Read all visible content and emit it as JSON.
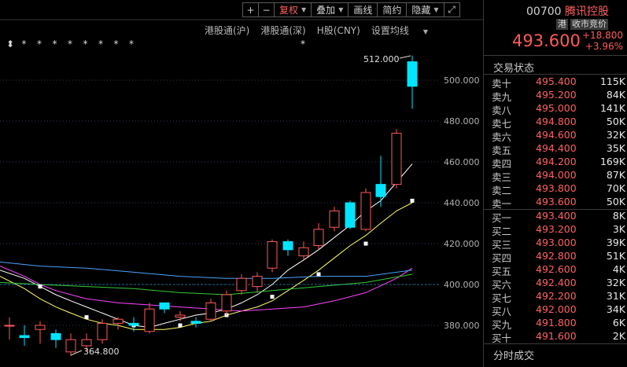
{
  "toolbar": {
    "plus": "+",
    "minus": "−",
    "fuquan": "复权",
    "diejia": "叠加",
    "huaxian": "画线",
    "jianyue": "简约",
    "yincang": "隐藏",
    "expand": "⤢"
  },
  "subbar": {
    "hk_hu": "港股通(沪)",
    "hk_shen": "港股通(深)",
    "hshare": "H股(CNY)",
    "ma_settings": "设置均线"
  },
  "stars": [
    "⬍",
    "*",
    "*",
    "*",
    "*",
    "*",
    "*",
    "*",
    "*"
  ],
  "star_right": "*",
  "annotations": {
    "high": "512.000",
    "low": "364.800"
  },
  "y_axis": [
    "500.000",
    "480.000",
    "460.000",
    "440.000",
    "420.000",
    "400.000",
    "380.000"
  ],
  "quote": {
    "code": "00700",
    "name": "腾讯控股",
    "tag1": "港",
    "tag2": "收市竞价",
    "price": "493.600",
    "change": "+18.800",
    "change_pct": "+3.96%"
  },
  "orderbook_title": "交易状态",
  "asks": [
    {
      "label": "卖十",
      "price": "495.400",
      "vol": "115K"
    },
    {
      "label": "卖九",
      "price": "495.200",
      "vol": "84K"
    },
    {
      "label": "卖八",
      "price": "495.000",
      "vol": "141K"
    },
    {
      "label": "卖七",
      "price": "494.800",
      "vol": "50K"
    },
    {
      "label": "卖六",
      "price": "494.600",
      "vol": "32K"
    },
    {
      "label": "卖五",
      "price": "494.400",
      "vol": "35K"
    },
    {
      "label": "卖四",
      "price": "494.200",
      "vol": "169K"
    },
    {
      "label": "卖三",
      "price": "494.000",
      "vol": "87K"
    },
    {
      "label": "卖二",
      "price": "493.800",
      "vol": "70K"
    },
    {
      "label": "卖一",
      "price": "493.600",
      "vol": "50K"
    }
  ],
  "bids": [
    {
      "label": "买一",
      "price": "493.400",
      "vol": "8K"
    },
    {
      "label": "买二",
      "price": "493.200",
      "vol": "3K"
    },
    {
      "label": "买三",
      "price": "493.000",
      "vol": "39K"
    },
    {
      "label": "买四",
      "price": "492.800",
      "vol": "51K"
    },
    {
      "label": "买五",
      "price": "492.600",
      "vol": "4K"
    },
    {
      "label": "买六",
      "price": "492.400",
      "vol": "32K"
    },
    {
      "label": "买七",
      "price": "492.200",
      "vol": "31K"
    },
    {
      "label": "买八",
      "price": "492.000",
      "vol": "34K"
    },
    {
      "label": "买九",
      "price": "491.800",
      "vol": "6K"
    },
    {
      "label": "买十",
      "price": "491.600",
      "vol": "2K"
    }
  ],
  "bottom_tab": "分时成交",
  "colors": {
    "up": "#ff5a5a",
    "down": "#00e5ff",
    "ma5": "#ffffff",
    "ma10": "#ffff66",
    "ma20": "#ff44ff",
    "ma30": "#33cc33",
    "ma60": "#4aa3ff"
  }
}
